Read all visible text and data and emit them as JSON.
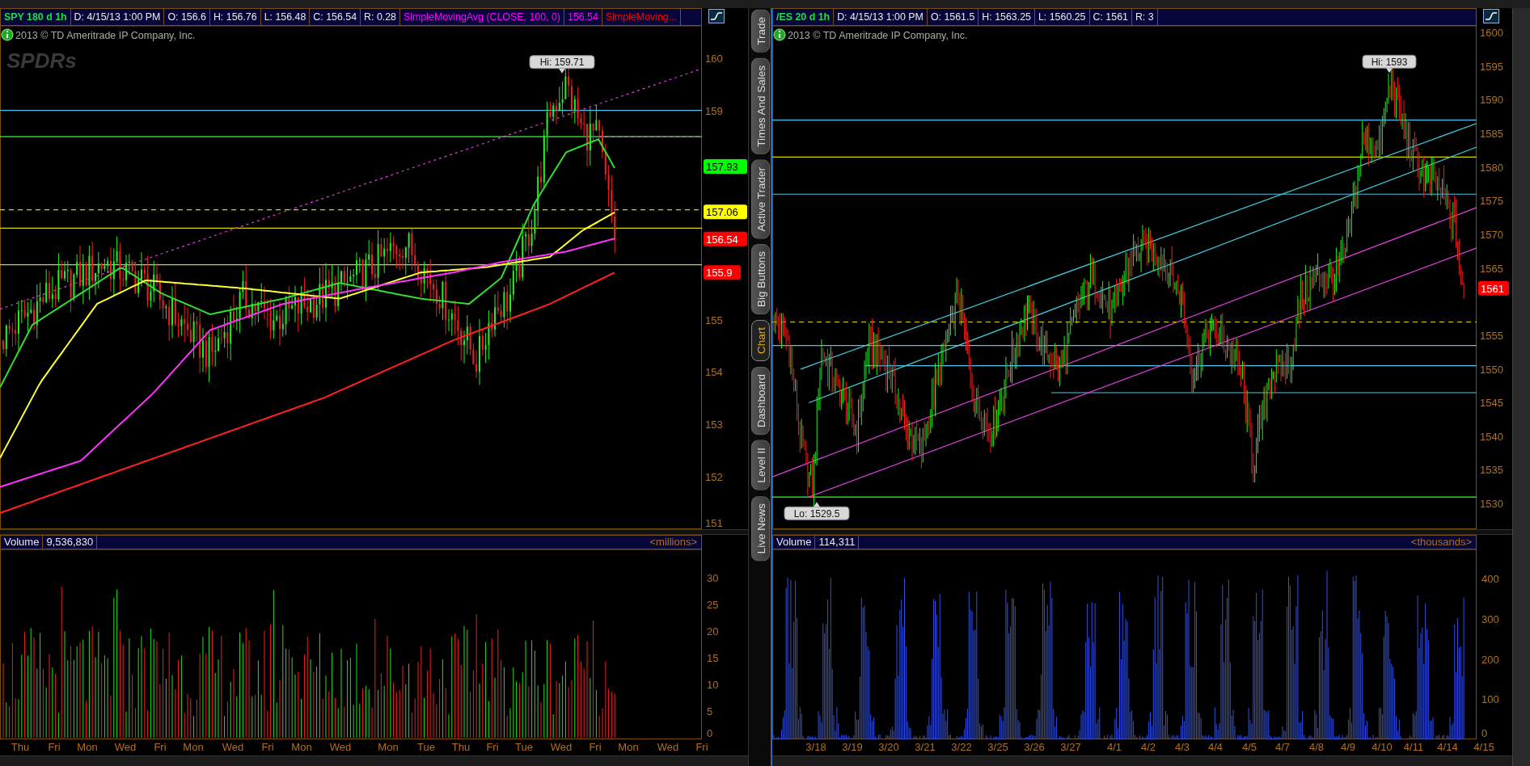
{
  "charts": [
    {
      "symbol": "SPY 180 d 1h",
      "fields": [
        "D: 4/15/13 1:00 PM",
        "O: 156.6",
        "H: 156.76",
        "L: 156.48",
        "C: 156.54",
        "R: 0.28"
      ],
      "studies": [
        {
          "text": "SimpleMovingAvg (CLOSE, 100, 0)",
          "color": "#ff00ff"
        },
        {
          "text": "156.54",
          "color": "#ff00ff"
        },
        {
          "text": "SimpleMoving...",
          "color": "#ff0000"
        }
      ],
      "copyright": "2013 © TD Ameritrade IP Company, Inc.",
      "logo": "SPDRs",
      "price_ticks": [
        "160",
        "159",
        "155",
        "154",
        "153",
        "152",
        "151"
      ],
      "price_tags": [
        {
          "text": "157.93",
          "color": "#00ff00"
        },
        {
          "text": "157.06",
          "color": "#ffff00"
        },
        {
          "text": "156.54",
          "color": "#ff0000"
        },
        {
          "text": "155.9",
          "color": "#ff0000"
        }
      ],
      "callouts": [
        {
          "text": "Hi: 159.71"
        }
      ],
      "volume": {
        "label": "Volume",
        "value": "9,536,830",
        "unit": "<millions>",
        "ticks": [
          "30",
          "25",
          "20",
          "15",
          "10",
          "5",
          "0"
        ]
      },
      "time_labels": [
        "Thu",
        "Fri",
        "Mon",
        "Wed",
        "Fri",
        "Mon",
        "Wed",
        "Fri",
        "Mon",
        "Wed",
        "Mon",
        "Tue",
        "Thu",
        "Fri",
        "Tue",
        "Wed",
        "Fri",
        "Mon",
        "Wed",
        "Fri"
      ]
    },
    {
      "symbol": "/ES 20 d 1h",
      "fields": [
        "D: 4/15/13 1:00 PM",
        "O: 1561.5",
        "H: 1563.25",
        "L: 1560.25",
        "C: 1561",
        "R: 3"
      ],
      "copyright": "2013 © TD Ameritrade IP Company, Inc.",
      "price_ticks": [
        "1600",
        "1595",
        "1590",
        "1585",
        "1580",
        "1575",
        "1570",
        "1565",
        "1555",
        "1550",
        "1545",
        "1540",
        "1535",
        "1530"
      ],
      "price_tags": [
        {
          "text": "1561",
          "color": "#ff0000"
        }
      ],
      "callouts": [
        {
          "text": "Hi: 1593"
        },
        {
          "text": "Lo: 1529.5"
        }
      ],
      "volume": {
        "label": "Volume",
        "value": "114,311",
        "unit": "<thousands>",
        "ticks": [
          "400",
          "300",
          "200",
          "100",
          "0"
        ]
      },
      "time_labels": [
        "3/18",
        "3/19",
        "3/20",
        "3/21",
        "3/22",
        "3/25",
        "3/26",
        "3/27",
        "4/1",
        "4/2",
        "4/3",
        "4/4",
        "4/5",
        "4/7",
        "4/8",
        "4/9",
        "4/10",
        "4/11",
        "4/14",
        "4/15"
      ]
    }
  ],
  "side_tabs": [
    {
      "label": "Trade",
      "selected": false
    },
    {
      "label": "Times And Sales",
      "selected": false
    },
    {
      "label": "Active Trader",
      "selected": false
    },
    {
      "label": "Big Buttons",
      "selected": false
    },
    {
      "label": "Chart",
      "selected": true
    },
    {
      "label": "Dashboard",
      "selected": false
    },
    {
      "label": "Level II",
      "selected": false
    },
    {
      "label": "Live News",
      "selected": false
    }
  ]
}
